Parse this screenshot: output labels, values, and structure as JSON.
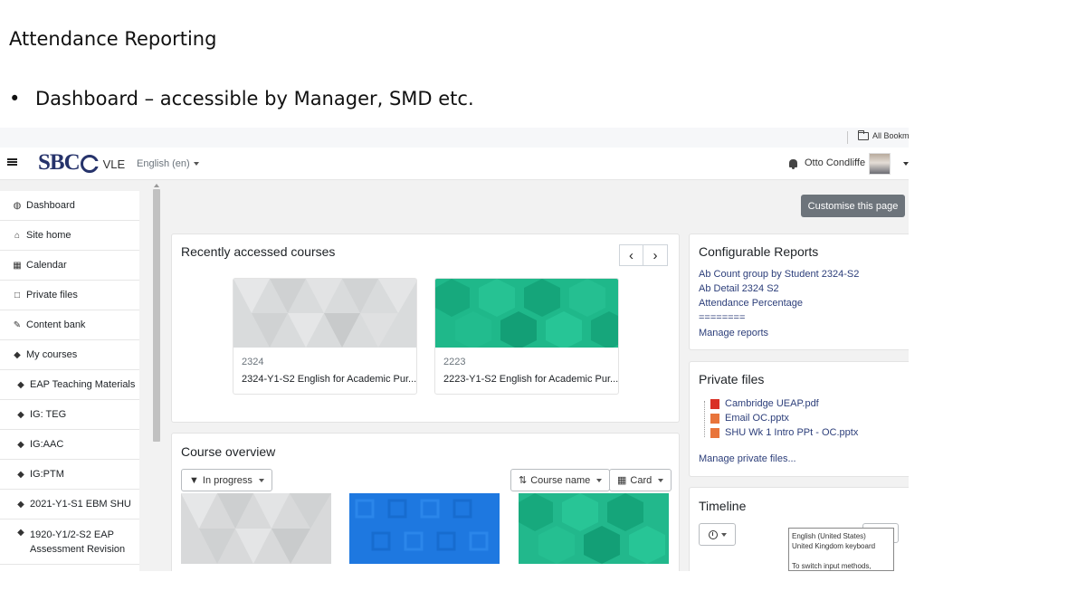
{
  "slide": {
    "title": "Attendance Reporting",
    "bullet": "Dashboard – accessible by Manager, SMD etc."
  },
  "browser": {
    "bookmarks_label": "All Bookma"
  },
  "navbar": {
    "logo_text": "SBC",
    "logo_suffix": "VLE",
    "language": "English (en)",
    "user_name": "Otto Condliffe"
  },
  "sidebar": {
    "items": [
      {
        "label": "Dashboard",
        "icon": "dashboard-icon",
        "glyph": "◍"
      },
      {
        "label": "Site home",
        "icon": "home-icon",
        "glyph": "⌂"
      },
      {
        "label": "Calendar",
        "icon": "calendar-icon",
        "glyph": "▦"
      },
      {
        "label": "Private files",
        "icon": "file-icon",
        "glyph": "□"
      },
      {
        "label": "Content bank",
        "icon": "paint-brush-icon",
        "glyph": "✎"
      },
      {
        "label": "My courses",
        "icon": "graduation-cap-icon",
        "glyph": "◆"
      },
      {
        "label": "EAP Teaching Materials",
        "icon": "graduation-cap-icon",
        "glyph": "◆"
      },
      {
        "label": "IG: TEG",
        "icon": "graduation-cap-icon",
        "glyph": "◆"
      },
      {
        "label": "IG:AAC",
        "icon": "graduation-cap-icon",
        "glyph": "◆"
      },
      {
        "label": "IG:PTM",
        "icon": "graduation-cap-icon",
        "glyph": "◆"
      },
      {
        "label": "2021-Y1-S1 EBM SHU",
        "icon": "graduation-cap-icon",
        "glyph": "◆"
      },
      {
        "label": "1920-Y1/2-S2 EAP Assessment Revision",
        "icon": "graduation-cap-icon",
        "glyph": "◆"
      }
    ]
  },
  "main": {
    "customise_label": "Customise this page",
    "recent": {
      "title": "Recently accessed courses",
      "prev": "‹",
      "next": "›",
      "courses": [
        {
          "code": "2324",
          "name": "2324-Y1-S2 English for Academic Pur...",
          "color": "#d5d7d8"
        },
        {
          "code": "2223",
          "name": "2223-Y1-S2 English for Academic Pur...",
          "color": "#1fb88a"
        }
      ]
    },
    "overview": {
      "title": "Course overview",
      "filter_label": "In progress",
      "sort_label": "Course name",
      "view_label": "Card",
      "card_colors": [
        "#d8d9da",
        "#1e78e0",
        "#22b88c"
      ]
    }
  },
  "right": {
    "reports": {
      "title": "Configurable Reports",
      "links": [
        "Ab Count group by Student 2324-S2",
        "Ab Detail 2324 S2",
        "Attendance Percentage",
        "========",
        "Manage reports"
      ]
    },
    "private_files": {
      "title": "Private files",
      "files": [
        {
          "name": "Cambridge UEAP.pdf",
          "icon": "pdf-icon",
          "color": "#d93025"
        },
        {
          "name": "Email OC.pptx",
          "icon": "pptx-icon",
          "color": "#e8743b"
        },
        {
          "name": "SHU Wk 1 Intro PPt - OC.pptx",
          "icon": "pptx-icon",
          "color": "#e8743b"
        }
      ],
      "manage_label": "Manage private files..."
    },
    "timeline": {
      "title": "Timeline"
    }
  },
  "ime_tooltip": {
    "line1": "English (United States)",
    "line2": "United Kingdom keyboard",
    "line3": "To switch input methods, press"
  }
}
